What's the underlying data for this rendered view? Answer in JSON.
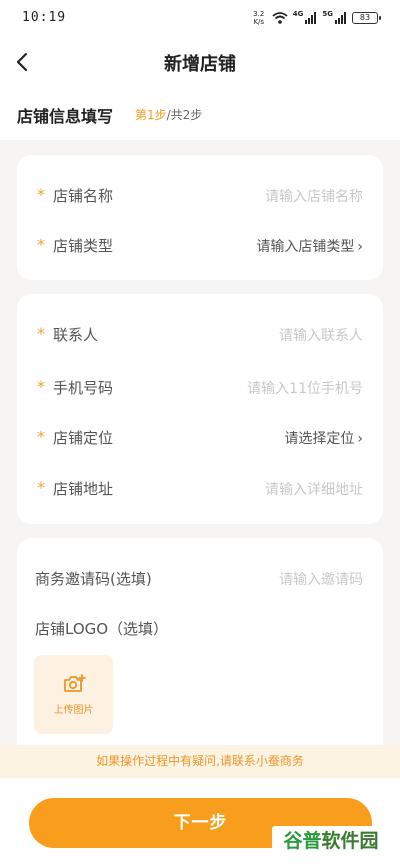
{
  "status_bar": {
    "time": "10:19",
    "net_speed_top": "3.2",
    "net_speed_bottom": "K/s",
    "signal1": "4G",
    "signal2": "5G",
    "battery": "83"
  },
  "nav": {
    "title": "新增店铺"
  },
  "step": {
    "title": "店铺信息填写",
    "current": "第1步",
    "total": "/共2步"
  },
  "card1": {
    "store_name": {
      "label": "店铺名称",
      "placeholder": "请输入店铺名称"
    },
    "store_type": {
      "label": "店铺类型",
      "value": "请输入店铺类型"
    }
  },
  "card2": {
    "contact": {
      "label": "联系人",
      "placeholder": "请输入联系人"
    },
    "phone": {
      "label": "手机号码",
      "placeholder": "请输入11位手机号"
    },
    "location": {
      "label": "店铺定位",
      "value": "请选择定位"
    },
    "address": {
      "label": "店铺地址",
      "placeholder": "请输入详细地址"
    }
  },
  "card3": {
    "invite": {
      "label": "商务邀请码(选填)",
      "placeholder": "请输入邀请码"
    },
    "logo": {
      "label": "店铺LOGO（选填）",
      "upload_label": "上传图片"
    }
  },
  "required_mark": "*",
  "notice": "如果操作过程中有疑问,请联系小蚕商务",
  "next_button": "下一步",
  "watermark": {
    "part1": "谷普",
    "part2": "软件园"
  },
  "colors": {
    "accent": "#f99d1c",
    "required": "#f2a33a",
    "background": "#f6f5f3"
  }
}
